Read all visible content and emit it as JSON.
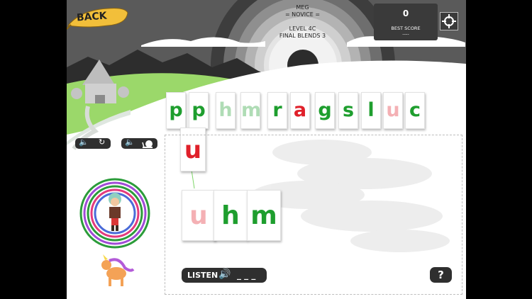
{
  "header": {
    "back_label": "BACK",
    "player_name": "MEG",
    "player_rank": "= NOVICE =",
    "level": "LEVEL 4C",
    "lesson": "FINAL BLENDS 3"
  },
  "score": {
    "value": "0",
    "best_label": "BEST SCORE",
    "best_value": "----"
  },
  "letter_bank": [
    {
      "letter": "p",
      "color": "#1e9e2e",
      "dim": false
    },
    {
      "letter": "p",
      "color": "#1e9e2e",
      "dim": false
    },
    {
      "letter": "h",
      "color": "#1e9e2e",
      "dim": true
    },
    {
      "letter": "m",
      "color": "#1e9e2e",
      "dim": true
    },
    {
      "letter": "r",
      "color": "#1e9e2e",
      "dim": false
    },
    {
      "letter": "a",
      "color": "#e0202a",
      "dim": false
    },
    {
      "letter": "g",
      "color": "#1e9e2e",
      "dim": false
    },
    {
      "letter": "s",
      "color": "#1e9e2e",
      "dim": false
    },
    {
      "letter": "l",
      "color": "#1e9e2e",
      "dim": false
    },
    {
      "letter": "u",
      "color": "#e0202a",
      "dim": true
    },
    {
      "letter": "c",
      "color": "#1e9e2e",
      "dim": false
    }
  ],
  "dragged_tile": {
    "letter": "u",
    "color": "#e0202a"
  },
  "word_slots": [
    {
      "letter": "u",
      "color": "#e0202a",
      "dim": true
    },
    {
      "letter": "h",
      "color": "#1e9e2e",
      "dim": false
    },
    {
      "letter": "m",
      "color": "#1e9e2e",
      "dim": false
    }
  ],
  "controls": {
    "listen_label": "LISTEN",
    "listen_blanks": "_ _ _",
    "help_label": "?",
    "sound_replay_icon": "replay-icon",
    "sound_slow_icon": "snail-icon"
  },
  "progress": {
    "target_rings": 5
  }
}
